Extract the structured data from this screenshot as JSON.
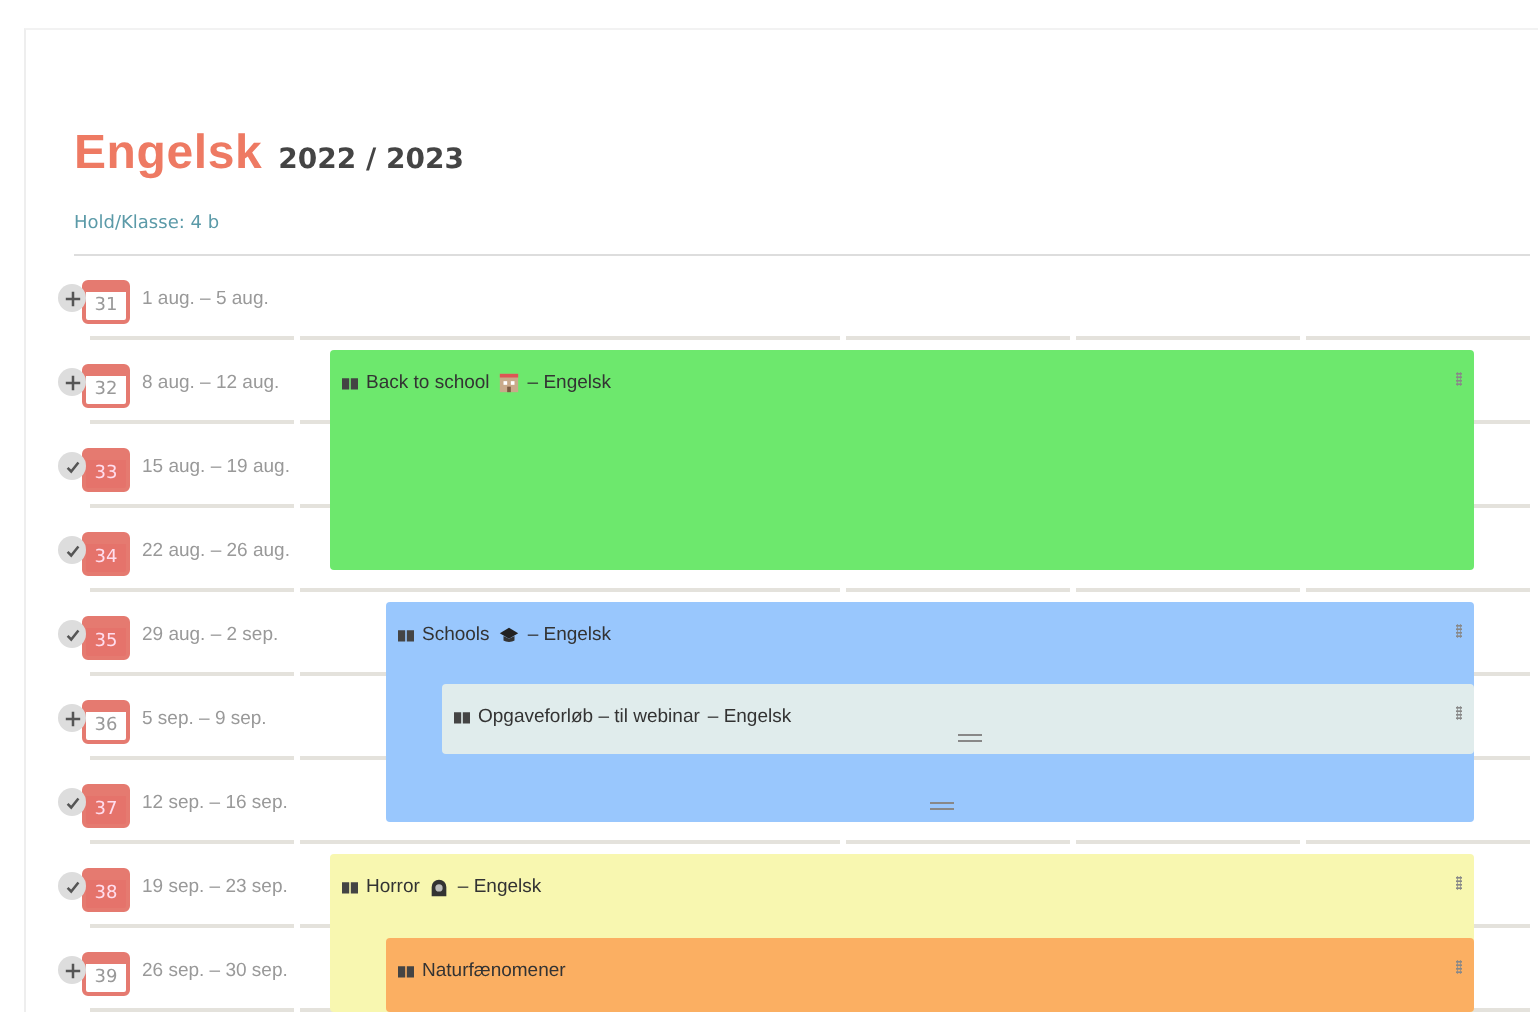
{
  "header": {
    "subject": "Engelsk",
    "year": "2022 / 2023",
    "class_label": "Hold/Klasse: 4 b"
  },
  "weeks": [
    {
      "number": "31",
      "dates": "1 aug. – 5 aug.",
      "done": false
    },
    {
      "number": "32",
      "dates": "8 aug. – 12 aug.",
      "done": false
    },
    {
      "number": "33",
      "dates": "15 aug. – 19 aug.",
      "done": true
    },
    {
      "number": "34",
      "dates": "22 aug. – 26 aug.",
      "done": true
    },
    {
      "number": "35",
      "dates": "29 aug. – 2 sep.",
      "done": true
    },
    {
      "number": "36",
      "dates": "5 sep. – 9 sep.",
      "done": false
    },
    {
      "number": "37",
      "dates": "12 sep. – 16 sep.",
      "done": true
    },
    {
      "number": "38",
      "dates": "19 sep. – 23 sep.",
      "done": true
    },
    {
      "number": "39",
      "dates": "26 sep. – 30 sep.",
      "done": false
    }
  ],
  "courses": [
    {
      "title": "Back to school",
      "subject": "– Engelsk",
      "color": "#6de86d"
    },
    {
      "title": "Schools",
      "subject": "– Engelsk",
      "color": "#99c7fd",
      "children": [
        {
          "title": "Opgaveforløb – til webinar",
          "subject": "– Engelsk",
          "color": "#e0ecec"
        }
      ]
    },
    {
      "title": "Horror",
      "subject": "– Engelsk",
      "color": "#f8f7b0",
      "children": [
        {
          "title": "Naturfænomener",
          "color": "#fbaf62"
        }
      ]
    }
  ]
}
